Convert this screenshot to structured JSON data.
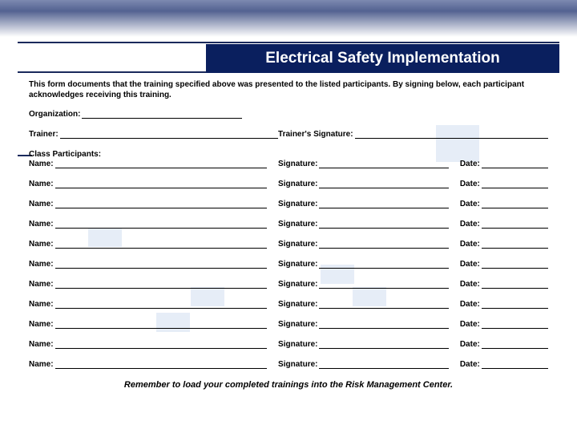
{
  "title": "Electrical Safety Implementation",
  "intro": "This form documents that the training specified above was presented to the listed participants. By signing below, each participant acknowledges receiving this training.",
  "labels": {
    "organization": "Organization:",
    "trainer": "Trainer:",
    "trainer_signature": "Trainer's Signature:",
    "class_participants": "Class Participants:",
    "name": "Name:",
    "signature": "Signature:",
    "date": "Date:"
  },
  "footer": "Remember to load your completed trainings into the Risk Management Center.",
  "values": {
    "organization": "",
    "trainer": "",
    "trainer_signature": "",
    "rows": [
      {
        "name": "",
        "signature": "",
        "date": ""
      },
      {
        "name": "",
        "signature": "",
        "date": ""
      },
      {
        "name": "",
        "signature": "",
        "date": ""
      },
      {
        "name": "",
        "signature": "",
        "date": ""
      },
      {
        "name": "",
        "signature": "",
        "date": ""
      },
      {
        "name": "",
        "signature": "",
        "date": ""
      },
      {
        "name": "",
        "signature": "",
        "date": ""
      },
      {
        "name": "",
        "signature": "",
        "date": ""
      },
      {
        "name": "",
        "signature": "",
        "date": ""
      },
      {
        "name": "",
        "signature": "",
        "date": ""
      },
      {
        "name": "",
        "signature": "",
        "date": ""
      }
    ]
  }
}
